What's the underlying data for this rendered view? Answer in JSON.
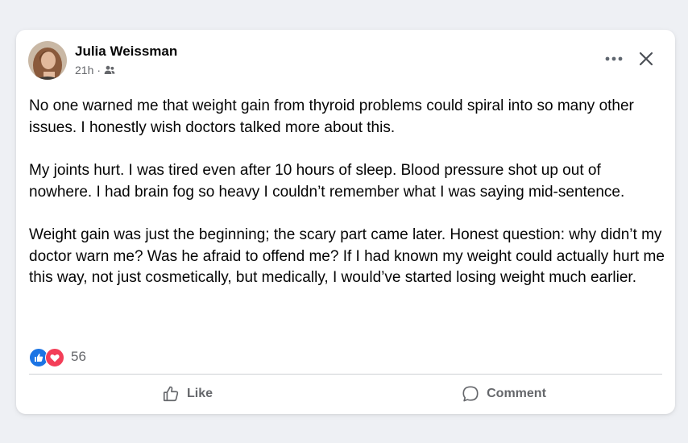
{
  "post": {
    "author": "Julia Weissman",
    "time": "21h",
    "separator": "·",
    "audience_icon": "friends-icon",
    "paragraphs": [
      "No one warned me that weight gain from thyroid problems could spiral into so many other issues. I honestly wish doctors talked more about this.",
      "My joints hurt. I was tired even after 10 hours of sleep. Blood pressure shot up out of nowhere. I had brain fog so heavy I couldn’t remember what I was saying mid-sentence.",
      "Weight gain was just the beginning; the scary part came later. Honest question: why didn’t my doctor warn me? Was he afraid to offend me? If I had known my weight could actually hurt me this way, not just cosmetically, but medically, I would’ve started losing weight much earlier."
    ],
    "reactions": {
      "icons": [
        "like-reaction-icon",
        "love-reaction-icon"
      ],
      "count": "56"
    }
  },
  "actions": {
    "like_label": "Like",
    "comment_label": "Comment"
  },
  "colors": {
    "like_blue": "#1b74e4",
    "love_red": "#f33e58",
    "secondary_text": "#65676b",
    "primary_text": "#050505"
  }
}
